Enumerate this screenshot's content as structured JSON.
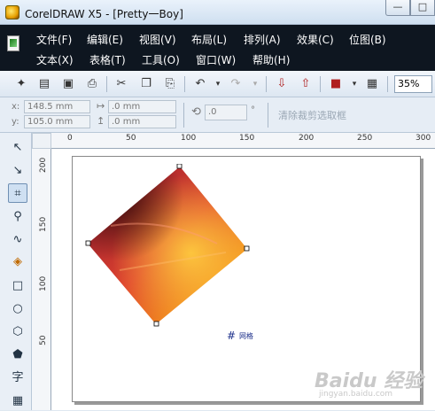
{
  "window": {
    "title": "CorelDRAW X5 - [Pretty一Boy]",
    "minimize": "—",
    "maximize": "□"
  },
  "menu": {
    "row1": [
      "文件(F)",
      "编辑(E)",
      "视图(V)",
      "布局(L)",
      "排列(A)",
      "效果(C)",
      "位图(B)"
    ],
    "row2": [
      "文本(X)",
      "表格(T)",
      "工具(O)",
      "窗口(W)",
      "帮助(H)"
    ]
  },
  "toolbar": {
    "zoom": "35%"
  },
  "propbar": {
    "x_label": "x:",
    "x_value": "148.5 mm",
    "y_label": "y:",
    "y_value": "105.0 mm",
    "w_value": ".0 mm",
    "h_value": ".0 mm",
    "rotation_value": ".0",
    "degree": "°",
    "clear_crop": "清除裁剪选取框"
  },
  "ruler": {
    "h_ticks": [
      "0",
      "50",
      "100",
      "150",
      "200",
      "250",
      "300"
    ],
    "v_ticks": [
      "200",
      "150",
      "100",
      "50"
    ]
  },
  "toolbox": {
    "text_tool": "字"
  },
  "canvas": {
    "grid_label": "网格",
    "grid_icon": "#"
  },
  "watermark": {
    "brand": "Baidu 经验",
    "url": "jingyan.baidu.com"
  },
  "colors": {
    "menubar": "#0e1620",
    "accent": "#1c2f8a"
  }
}
